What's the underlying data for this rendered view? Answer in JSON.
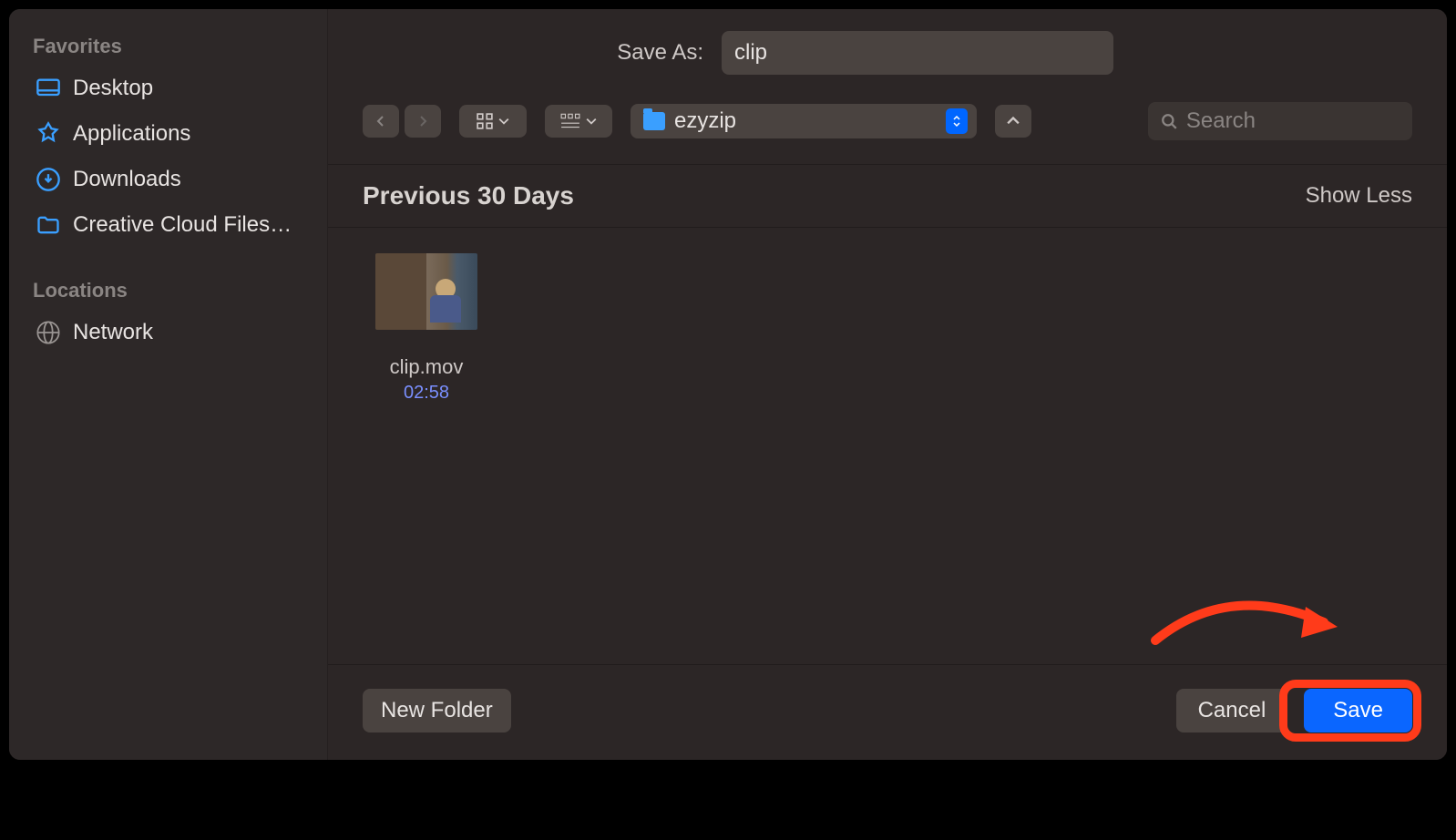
{
  "sidebar": {
    "favorites_label": "Favorites",
    "items": [
      {
        "icon": "desktop",
        "label": "Desktop"
      },
      {
        "icon": "applications",
        "label": "Applications"
      },
      {
        "icon": "downloads",
        "label": "Downloads"
      },
      {
        "icon": "folder",
        "label": "Creative Cloud Files…"
      }
    ],
    "locations_label": "Locations",
    "locations": [
      {
        "icon": "network",
        "label": "Network"
      }
    ]
  },
  "save_as": {
    "label": "Save As:",
    "value": "clip"
  },
  "toolbar": {
    "current_folder": "ezyzip",
    "search_placeholder": "Search"
  },
  "section": {
    "title": "Previous 30 Days",
    "show_less": "Show Less"
  },
  "files": [
    {
      "name": "clip.mov",
      "duration": "02:58"
    }
  ],
  "buttons": {
    "new_folder": "New Folder",
    "cancel": "Cancel",
    "save": "Save"
  },
  "colors": {
    "accent": "#0a66ff",
    "annotation": "#ff3b1a"
  }
}
